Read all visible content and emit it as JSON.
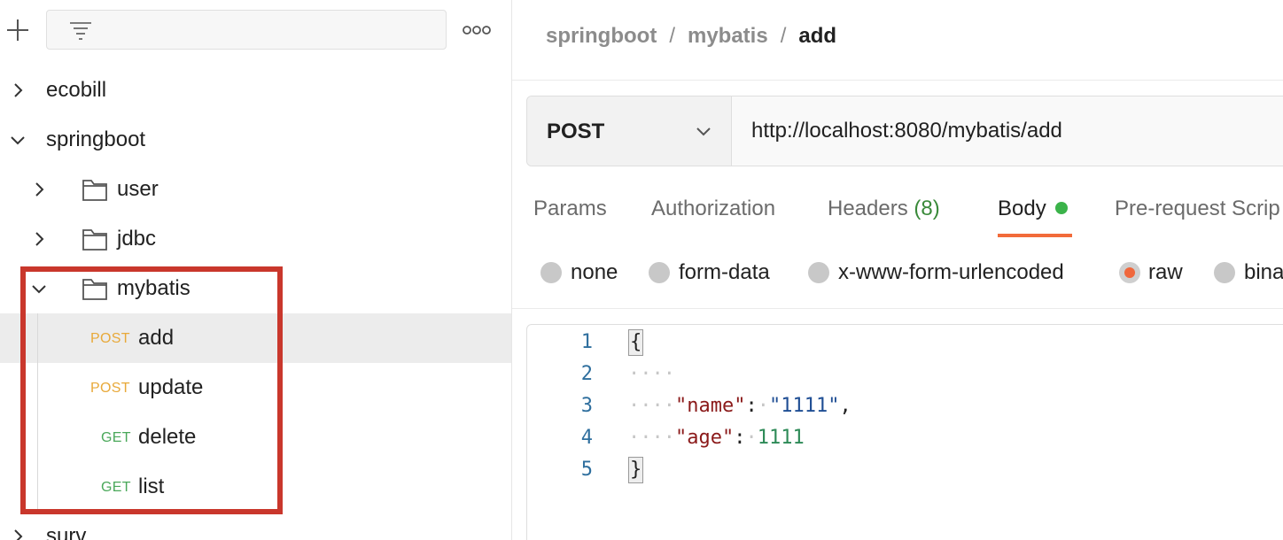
{
  "sidebar": {
    "filter_placeholder": "",
    "tree": [
      {
        "label": "ecobill",
        "expanded": false
      },
      {
        "label": "springboot",
        "expanded": true
      },
      {
        "label": "user",
        "type": "folder"
      },
      {
        "label": "jdbc",
        "type": "folder"
      },
      {
        "label": "mybatis",
        "type": "folder",
        "expanded": true
      },
      {
        "method": "POST",
        "label": "add",
        "selected": true
      },
      {
        "method": "POST",
        "label": "update"
      },
      {
        "method": "GET",
        "label": "delete"
      },
      {
        "method": "GET",
        "label": "list"
      },
      {
        "label": "surv"
      }
    ]
  },
  "main": {
    "breadcrumb": [
      "springboot",
      "mybatis",
      "add"
    ],
    "breadcrumb_sep": "/",
    "request": {
      "method": "POST",
      "url": "http://localhost:8080/mybatis/add"
    },
    "tabs": {
      "params": "Params",
      "authorization": "Authorization",
      "headers": "Headers",
      "headers_count": "(8)",
      "body": "Body",
      "prerequest": "Pre-request Scrip"
    },
    "body_types": {
      "none": "none",
      "form_data": "form-data",
      "urlencoded": "x-www-form-urlencoded",
      "raw": "raw",
      "binary": "bina"
    },
    "editor": {
      "line_numbers": [
        "1",
        "2",
        "3",
        "4",
        "5"
      ],
      "open_brace": "{",
      "indent": "····",
      "name_key": "\"name\"",
      "name_value": "\"1111\"",
      "age_key": "\"age\"",
      "age_value": "1111",
      "close_brace": "}"
    }
  },
  "colors": {
    "post": "#e8a93a",
    "get": "#4aa85a",
    "highlight": "#c9372c",
    "active_tab_underline": "#f26b3a",
    "body_dot": "#3bb34a"
  }
}
